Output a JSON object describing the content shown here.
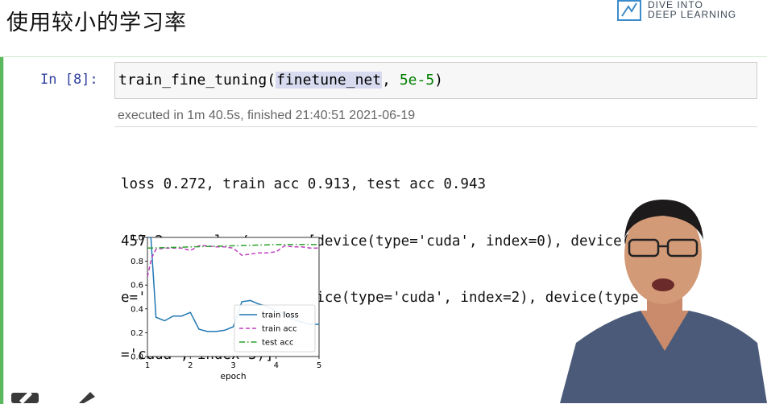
{
  "slide": {
    "title": "使用较小的学习率",
    "brand_line1": "DIVE INTO",
    "brand_line2": "DEEP LEARNING"
  },
  "cell": {
    "prompt": "In [8]:",
    "code_func": "train_fine_tuning(",
    "code_arg": "finetune_net",
    "code_sep": ", ",
    "code_num": "5e-5",
    "code_close": ")",
    "exec_info": "executed in 1m 40.5s, finished 21:40:51 2021-06-19",
    "output_lines": [
      "loss 0.272, train acc 0.913, test acc 0.943",
      "457.2 examples/sec on [device(type='cuda', index=0), device(typ",
      "e='cuda', index=1), device(type='cuda', index=2), device(type",
      "='cuda', index=3)]"
    ]
  },
  "colors": {
    "train_loss": "#1f77b4",
    "train_acc": "#bf3fbf",
    "test_acc": "#2ca02c",
    "cell_bar": "#5cb85c",
    "prompt": "#303f9f"
  },
  "chart_data": {
    "type": "line",
    "xlabel": "epoch",
    "ylabel": "",
    "xlim": [
      1,
      5
    ],
    "ylim": [
      0.0,
      1.0
    ],
    "xticks": [
      "1",
      "2",
      "3",
      "4",
      "5"
    ],
    "yticks": [
      "0.0",
      "0.2",
      "0.4",
      "0.6",
      "0.8",
      "1.0"
    ],
    "grid": false,
    "legend_position": "lower-right",
    "series": [
      {
        "name": "train loss",
        "style": "solid",
        "color": "#1f77b4",
        "x": [
          1.0,
          1.08,
          1.2,
          1.4,
          1.6,
          1.8,
          2.0,
          2.2,
          2.4,
          2.6,
          2.8,
          3.0,
          3.2,
          3.4,
          3.6,
          3.8,
          4.0,
          4.2,
          4.4,
          4.6,
          4.8,
          5.0
        ],
        "y": [
          1.0,
          1.0,
          0.33,
          0.3,
          0.34,
          0.34,
          0.37,
          0.23,
          0.21,
          0.21,
          0.22,
          0.25,
          0.46,
          0.47,
          0.44,
          0.42,
          0.38,
          0.36,
          0.31,
          0.29,
          0.27,
          0.27
        ]
      },
      {
        "name": "train acc",
        "style": "dashed",
        "color": "#bf3fbf",
        "x": [
          1.0,
          1.1,
          1.2,
          1.4,
          1.6,
          1.8,
          2.0,
          2.2,
          2.4,
          2.6,
          2.8,
          3.0,
          3.2,
          3.4,
          3.6,
          3.8,
          4.0,
          4.2,
          4.4,
          4.6,
          4.8,
          5.0
        ],
        "y": [
          0.67,
          0.83,
          0.9,
          0.91,
          0.91,
          0.91,
          0.89,
          0.93,
          0.93,
          0.92,
          0.92,
          0.91,
          0.85,
          0.86,
          0.87,
          0.87,
          0.88,
          0.93,
          0.92,
          0.92,
          0.91,
          0.91
        ]
      },
      {
        "name": "test acc",
        "style": "dashdot",
        "color": "#2ca02c",
        "x": [
          1,
          2,
          3,
          4,
          5
        ],
        "y": [
          0.91,
          0.92,
          0.93,
          0.94,
          0.94
        ]
      }
    ]
  }
}
